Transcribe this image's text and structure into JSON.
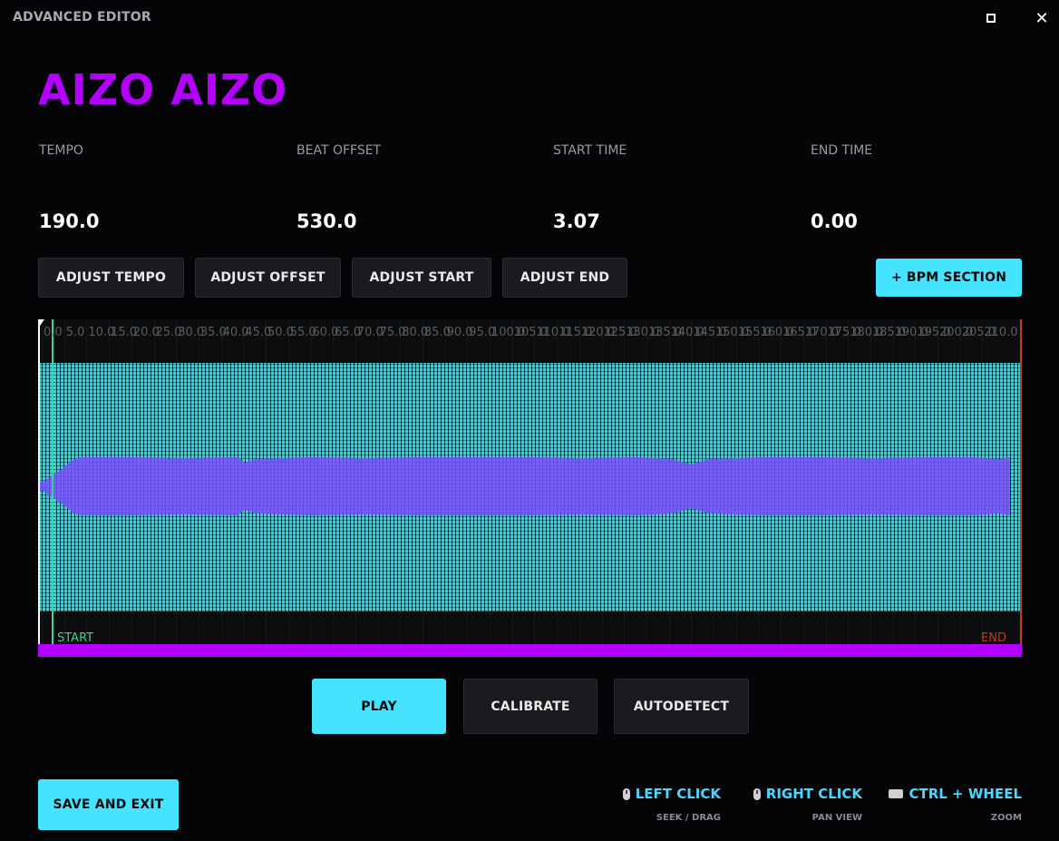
{
  "window": {
    "title": "ADVANCED EDITOR",
    "maximize_glyph": "□",
    "close_glyph": "✕"
  },
  "song": {
    "title": "AIZO AIZO",
    "title_color": "#b300ff"
  },
  "fields": [
    {
      "label": "TEMPO",
      "value": "190.0"
    },
    {
      "label": "BEAT OFFSET",
      "value": "530.0"
    },
    {
      "label": "START TIME",
      "value": "3.07"
    },
    {
      "label": "END TIME",
      "value": "0.00"
    }
  ],
  "adjust_buttons": [
    "ADJUST TEMPO",
    "ADJUST OFFSET",
    "ADJUST START",
    "ADJUST END"
  ],
  "bpm_section_button": "+ BPM SECTION",
  "timeline": {
    "start_label": "START",
    "end_label": "END",
    "ticks": [
      "0.0",
      "5.0",
      "10.0",
      "15.0",
      "20.0",
      "25.0",
      "30.0",
      "35.0",
      "40.0",
      "45.0",
      "50.0",
      "55.0",
      "60.0",
      "65.0",
      "70.0",
      "75.0",
      "80.0",
      "85.0",
      "90.0",
      "95.0",
      "100.0",
      "105.0",
      "110.0",
      "115.0",
      "120.0",
      "125.0",
      "130.0",
      "135.0",
      "140.0",
      "145.0",
      "150.0",
      "155.0",
      "160.0",
      "165.0",
      "170.0",
      "175.0",
      "180.0",
      "185.0",
      "190.0",
      "195.0",
      "200.0",
      "205.0",
      "210.0"
    ],
    "waveform_color": "#3fd6dd",
    "envelope_color": "#7a4dff",
    "range_bar_color": "#b300ff",
    "start_marker_color": "#3ed38f",
    "end_marker_color": "#c23b22"
  },
  "playback_buttons": {
    "play": "PLAY",
    "calibrate": "CALIBRATE",
    "autodetect": "AUTODETECT"
  },
  "save_button": "SAVE AND EXIT",
  "hints": [
    {
      "icon": "mouse-icon",
      "title": "LEFT CLICK",
      "sub": "SEEK / DRAG"
    },
    {
      "icon": "mouse-icon",
      "title": "RIGHT CLICK",
      "sub": "PAN VIEW"
    },
    {
      "icon": "keyboard-icon",
      "title": "CTRL + WHEEL",
      "sub": "ZOOM"
    }
  ],
  "accent_color": "#46e3ff"
}
